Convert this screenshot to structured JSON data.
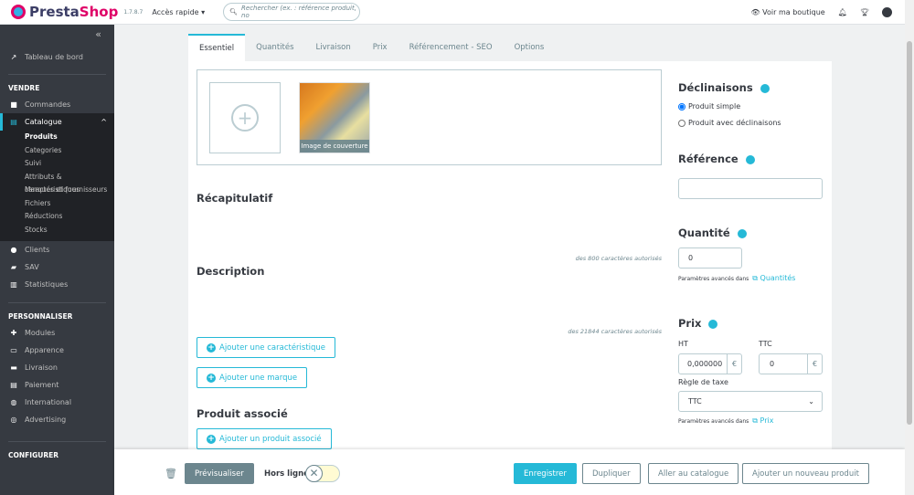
{
  "header": {
    "brand_a": "Presta",
    "brand_b": "Shop",
    "version": "1.7.8.7",
    "quick_access": "Accès rapide ▾",
    "search_placeholder": "Rechercher (ex. : référence produit, no",
    "view_shop": "Voir ma boutique"
  },
  "sidebar": {
    "collapse": "«",
    "dashboard": "Tableau de bord",
    "sections": [
      "VENDRE",
      "PERSONNALISER",
      "CONFIGURER"
    ],
    "sell_items": [
      "Commandes",
      "Catalogue",
      "Clients",
      "SAV",
      "Statistiques"
    ],
    "catalog_sub": [
      "Produits",
      "Categories",
      "Suivi",
      "Attributs & caractéristiques",
      "Marques et fournisseurs",
      "Fichiers",
      "Réductions",
      "Stocks"
    ],
    "custom_items": [
      "Modules",
      "Apparence",
      "Livraison",
      "Paiement",
      "International",
      "Advertising"
    ]
  },
  "tabs": [
    "Essentiel",
    "Quantités",
    "Livraison",
    "Prix",
    "Référencement - SEO",
    "Options"
  ],
  "main": {
    "cover_label": "Image de couverture",
    "summary": "Récapitulatif",
    "summary_hint": "des 800 caractères autorisés",
    "description": "Description",
    "description_hint": "des 21844 caractères autorisés",
    "add_feature": "Ajouter une caractéristique",
    "add_brand": "Ajouter une marque",
    "related": "Produit associé",
    "add_related": "Ajouter un produit associé"
  },
  "right": {
    "combinations": "Déclinaisons",
    "simple": "Produit simple",
    "with_comb": "Produit avec déclinaisons",
    "reference": "Référence",
    "reference_value": "",
    "quantity": "Quantité",
    "quantity_value": "0",
    "advanced": "Paramètres avancés dans",
    "quantities_link": "Quantités",
    "price": "Prix",
    "ht": "HT",
    "ttc": "TTC",
    "ht_value": "0,000000",
    "ttc_value": "0",
    "currency": "€",
    "tax_rule": "Règle de taxe",
    "tax_value": "TTC",
    "price_link": "Prix"
  },
  "footer": {
    "preview": "Prévisualiser",
    "offline": "Hors ligne",
    "save": "Enregistrer",
    "duplicate": "Dupliquer",
    "catalog": "Aller au catalogue",
    "new_product": "Ajouter un nouveau produit"
  },
  "colors": {
    "accent": "#25b9d7",
    "sidebar": "#363a41",
    "brand": "#df0067"
  }
}
